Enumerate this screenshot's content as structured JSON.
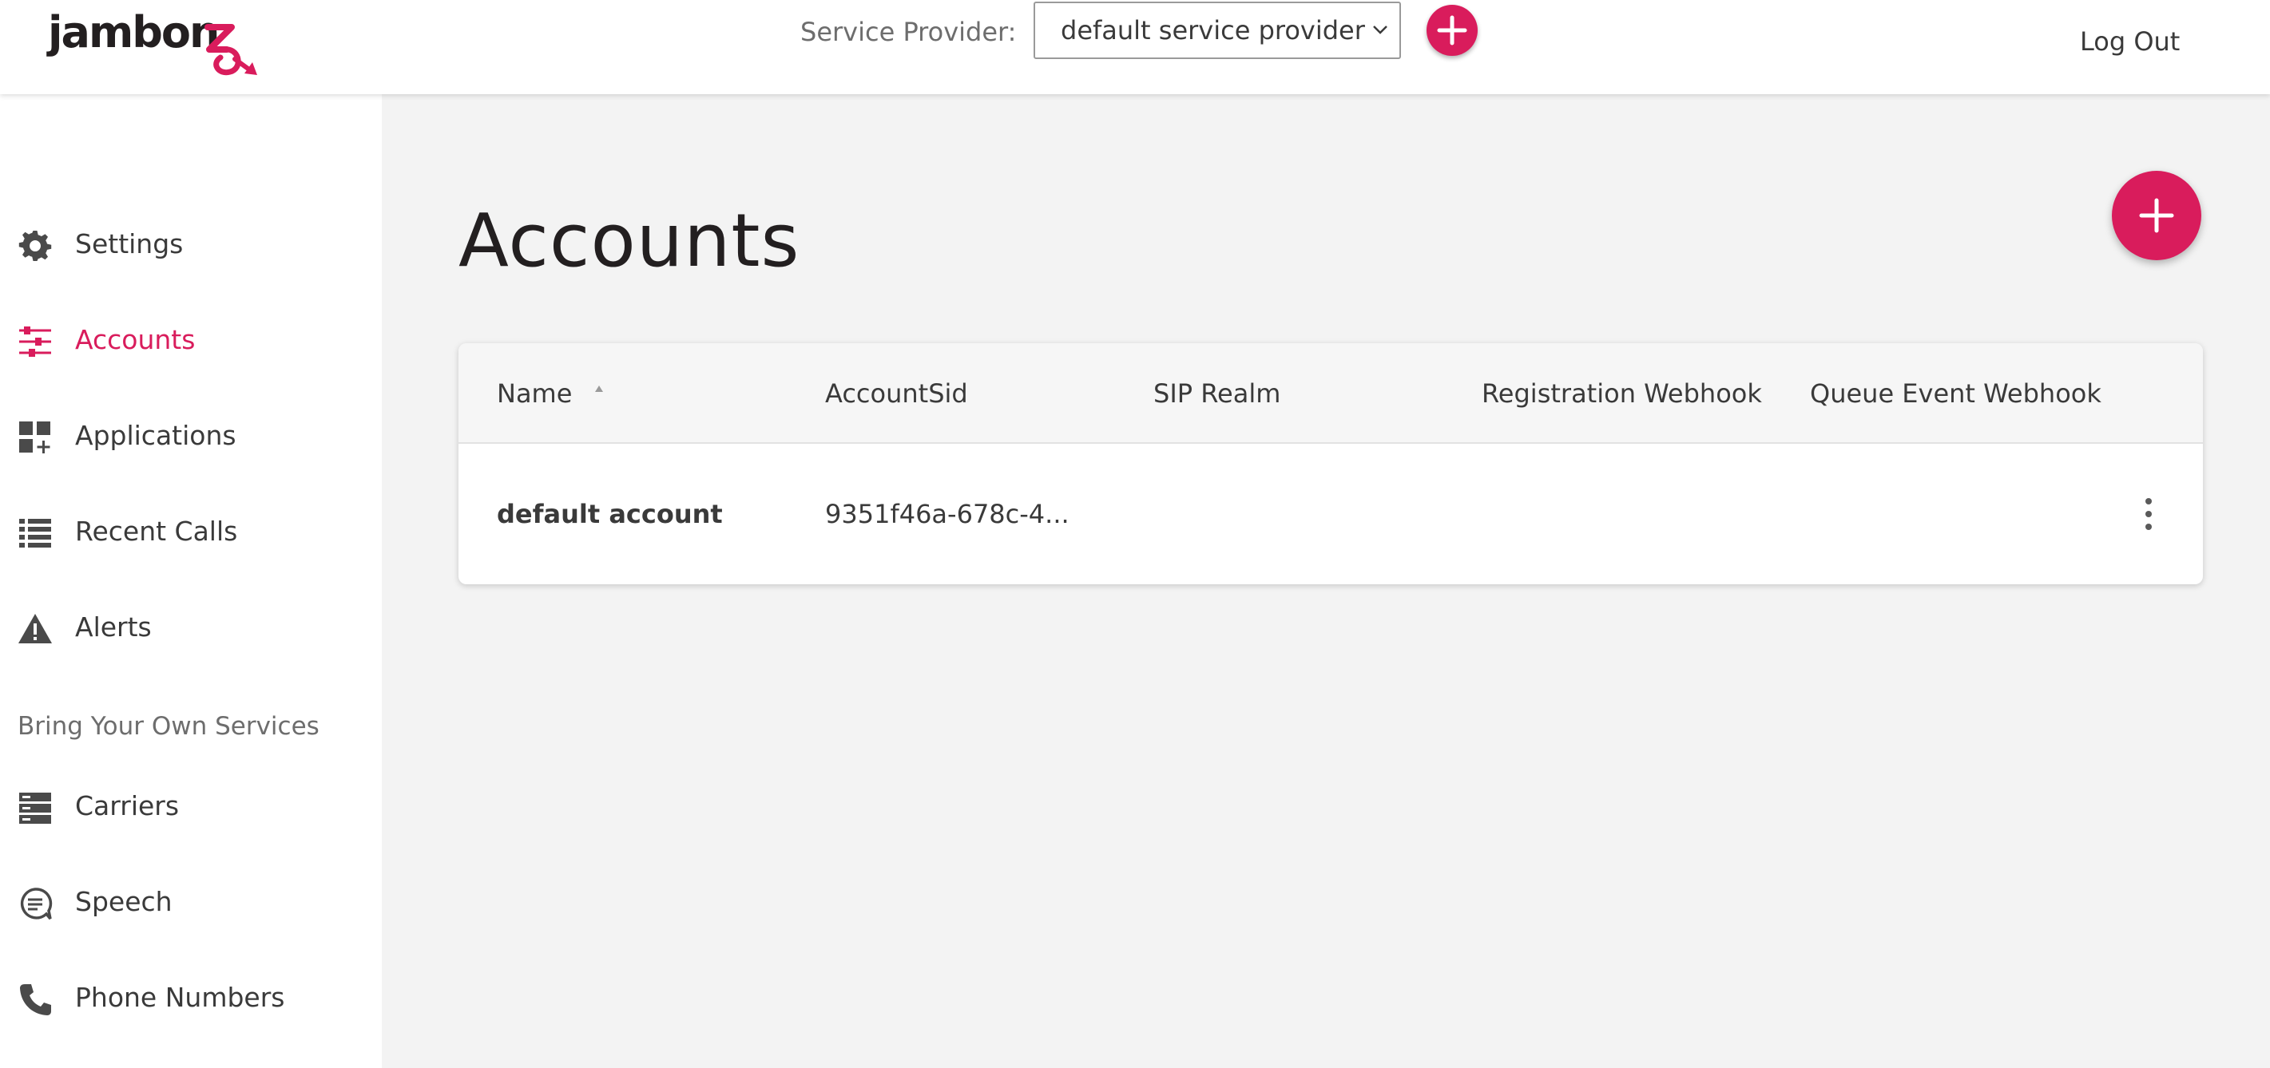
{
  "header": {
    "logo_text": "jambon",
    "service_provider_label": "Service Provider:",
    "service_provider_value": "default service provider",
    "logout_label": "Log Out"
  },
  "sidebar": {
    "items": [
      {
        "label": "Settings",
        "icon": "gear-icon"
      },
      {
        "label": "Accounts",
        "icon": "sliders-icon",
        "active": true
      },
      {
        "label": "Applications",
        "icon": "applications-icon"
      },
      {
        "label": "Recent Calls",
        "icon": "list-icon"
      },
      {
        "label": "Alerts",
        "icon": "warning-icon"
      }
    ],
    "section_title": "Bring Your Own Services",
    "byos_items": [
      {
        "label": "Carriers",
        "icon": "server-icon"
      },
      {
        "label": "Speech",
        "icon": "speech-bubble-icon"
      },
      {
        "label": "Phone Numbers",
        "icon": "phone-icon"
      }
    ]
  },
  "main": {
    "title": "Accounts",
    "table": {
      "columns": [
        "Name",
        "AccountSid",
        "SIP Realm",
        "Registration Webhook",
        "Queue Event Webhook"
      ],
      "rows": [
        {
          "name": "default account",
          "account_sid": "9351f46a-678c-4...",
          "sip_realm": "",
          "registration_webhook": "",
          "queue_event_webhook": ""
        }
      ]
    }
  },
  "colors": {
    "accent": "#d91c5c",
    "text": "#3a3a3a",
    "background": "#f3f3f3"
  }
}
